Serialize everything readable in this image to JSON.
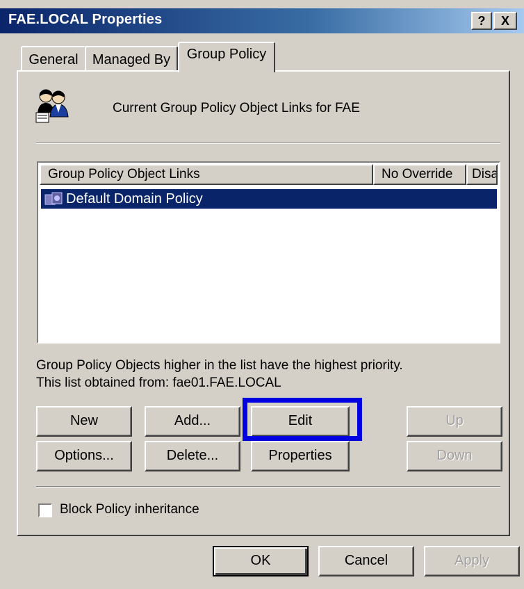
{
  "window": {
    "title": "FAE.LOCAL Properties"
  },
  "titlebar": {
    "help_glyph": "?",
    "close_glyph": "X"
  },
  "tabs": [
    {
      "label": "General",
      "active": false
    },
    {
      "label": "Managed By",
      "active": false
    },
    {
      "label": "Group Policy",
      "active": true
    }
  ],
  "panel": {
    "heading": "Current Group Policy Object Links for FAE",
    "list": {
      "columns": [
        "Group Policy Object Links",
        "No Override",
        "Disabled"
      ],
      "rows": [
        {
          "name": "Default Domain Policy",
          "no_override": "",
          "disabled": "",
          "selected": true
        }
      ]
    },
    "info_line1": "Group Policy Objects higher in the list have the highest priority.",
    "info_line2": "This list obtained from: fae01.FAE.LOCAL",
    "buttons": {
      "new": "New",
      "add": "Add...",
      "edit": "Edit",
      "up": "Up",
      "options": "Options...",
      "delete": "Delete...",
      "properties": "Properties",
      "down": "Down"
    },
    "block_inheritance": {
      "label": "Block Policy inheritance",
      "checked": false
    }
  },
  "footer": {
    "ok": "OK",
    "cancel": "Cancel",
    "apply": "Apply"
  },
  "colors": {
    "selection": "#0a246a",
    "highlight_box": "#0000e0",
    "face": "#d4d0c8"
  },
  "icons": [
    "users-icon",
    "gpo-icon"
  ]
}
